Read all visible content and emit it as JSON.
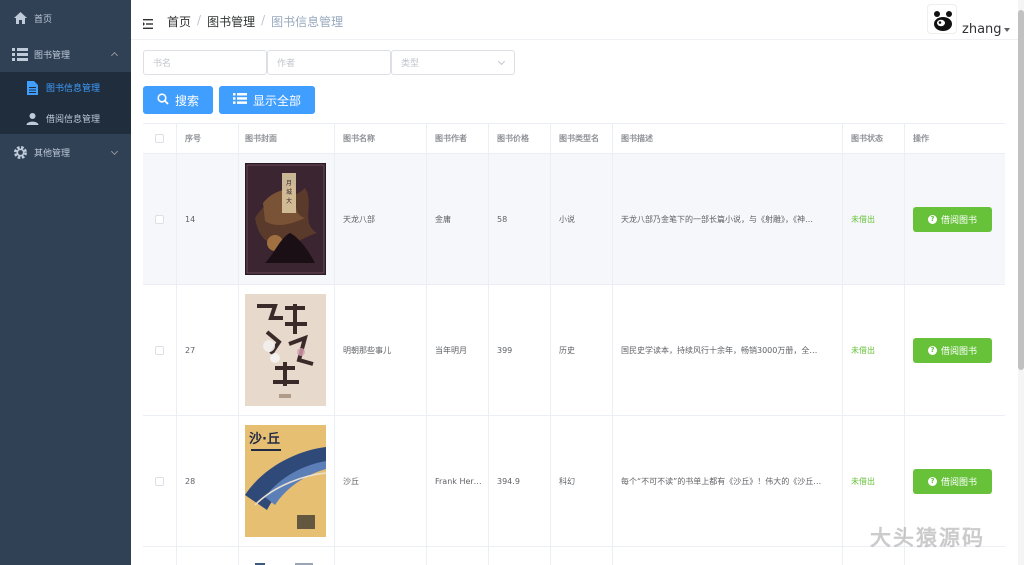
{
  "sidebar": {
    "home": "首页",
    "book_mgmt": "图书管理",
    "book_info": "图书信息管理",
    "borrow_info": "借阅信息管理",
    "other_mgmt": "其他管理"
  },
  "breadcrumb": [
    "首页",
    "图书管理",
    "图书信息管理"
  ],
  "user": {
    "name": "zhang"
  },
  "filters": {
    "name_placeholder": "书名",
    "author_placeholder": "作者",
    "type_placeholder": "类型"
  },
  "buttons": {
    "search": "搜索",
    "show_all": "显示全部"
  },
  "table": {
    "headers": [
      "序号",
      "图书封面",
      "图书名称",
      "图书作者",
      "图书价格",
      "图书类型名",
      "图书描述",
      "图书状态",
      "操作"
    ],
    "rows": [
      {
        "id": "14",
        "name": "天龙八部",
        "author": "金庸",
        "price": "58",
        "type": "小说",
        "desc": "天龙八部乃金笔下的一部长篇小说，与《射雕》，《神…",
        "status": "未借出",
        "action": "借阅图书"
      },
      {
        "id": "27",
        "name": "明朝那些事儿",
        "author": "当年明月",
        "price": "399",
        "type": "历史",
        "desc": "国民史学读本，持续风行十余年，畅销3000万册，全…",
        "status": "未借出",
        "action": "借阅图书"
      },
      {
        "id": "28",
        "name": "沙丘",
        "author": "Frank Her…",
        "price": "394.9",
        "type": "科幻",
        "desc": "每个“不可不读”的书单上都有《沙丘》！伟大的《沙丘…",
        "status": "未借出",
        "action": "借阅图书"
      }
    ]
  },
  "watermark": "大头猿源码",
  "colors": {
    "sidebar_bg": "#304156",
    "primary": "#409eff",
    "success": "#67c23a"
  }
}
